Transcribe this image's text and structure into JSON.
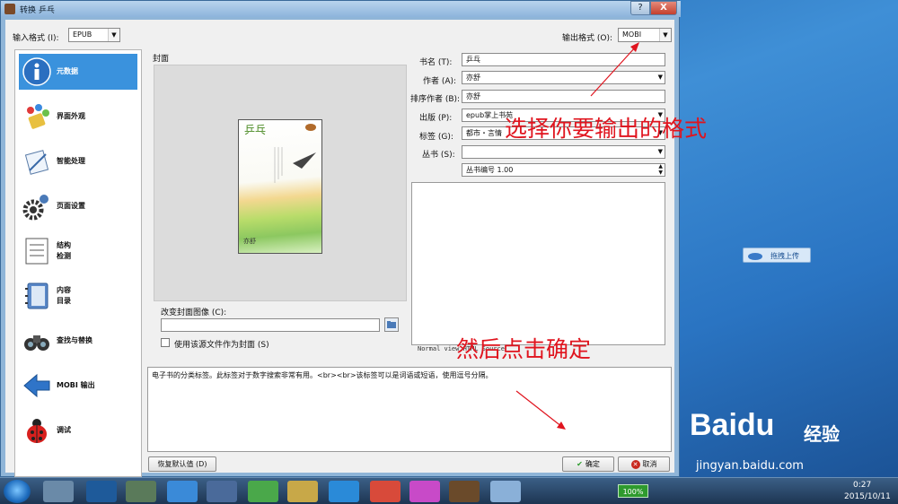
{
  "window": {
    "title": "转换 乒乓",
    "help": "?",
    "close": "X"
  },
  "input_format": {
    "label": "输入格式 (I):",
    "value": "EPUB"
  },
  "output_format": {
    "label": "输出格式 (O):",
    "value": "MOBI"
  },
  "sidebar": {
    "items": [
      {
        "label": "元数据",
        "icon": "info-icon",
        "active": true
      },
      {
        "label": "界面外观",
        "icon": "palette-icon"
      },
      {
        "label": "智能处理",
        "icon": "wand-icon"
      },
      {
        "label": "页面设置",
        "icon": "gear-icon"
      },
      {
        "label": "结构\n检测",
        "icon": "document-icon"
      },
      {
        "label": "内容\n目录",
        "icon": "notebook-icon"
      },
      {
        "label": "查找与替换",
        "icon": "binoculars-icon"
      },
      {
        "label": "MOBI 输出",
        "icon": "back-arrow-icon"
      },
      {
        "label": "调试",
        "icon": "ladybug-icon"
      }
    ]
  },
  "cover": {
    "label": "封面",
    "book_title": "乒乓",
    "author_mark": "亦舒",
    "change_label": "改变封面图像 (C):",
    "use_source_label": "使用该源文件作为封面 (S)"
  },
  "meta": {
    "title_label": "书名 (T):",
    "title": "乒乓",
    "author_label": "作者 (A):",
    "author": "亦舒",
    "sort_label": "排序作者 (B):",
    "sort": "亦舒",
    "publisher_label": "出版 (P):",
    "publisher": "epub掌上书苑",
    "tags_label": "标签 (G):",
    "tags": "都市・言情",
    "series_label": "丛书 (S):",
    "series": "",
    "series_index": "丛书编号 1.00",
    "comments_tabs": "Normal view   HTML Source"
  },
  "help_text": "电子书的分类标签。此标签对于数字搜索非常有用。<br><br>该标签可以是词语或短语，使用逗号分隔。",
  "buttons": {
    "restore": "恢复默认值 (D)",
    "ok": "确定",
    "cancel": "取消"
  },
  "annotations": {
    "choose_format": "选择你要输出的格式",
    "then_ok": "然后点击确定"
  },
  "desktop": {
    "upload": "拖拽上传",
    "baidu_logo": "Baidu",
    "baidu_cn": "经验",
    "baidu_url": "jingyan.baidu.com"
  },
  "taskbar": {
    "battery": "100%",
    "time": "0:27",
    "date": "2015/10/11"
  }
}
